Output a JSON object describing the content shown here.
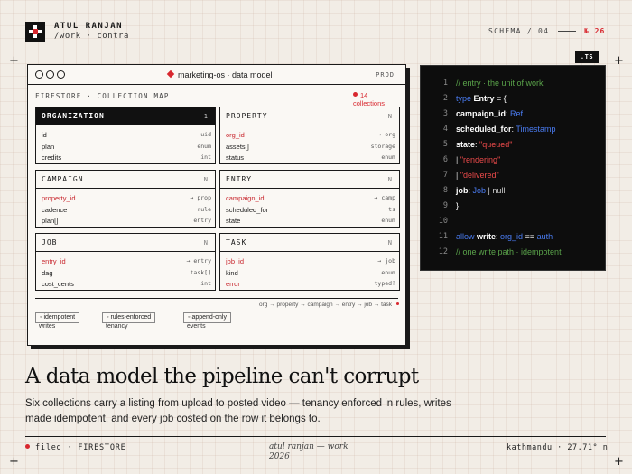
{
  "header": {
    "brand_name": "ATUL RANJAN",
    "brand_path": "/work · contra",
    "schema_label": "SCHEMA / 04",
    "page_index": "№ 26"
  },
  "panel": {
    "title": "marketing-os · data model",
    "env_badge": "PROD",
    "section_label": "FIRESTORE · COLLECTION MAP",
    "collection_count": "14",
    "collection_count_label": "collections",
    "cards": [
      {
        "name": "ORGANIZATION",
        "tag": "1",
        "rows": [
          {
            "field": "id",
            "type": "uid",
            "key": false
          },
          {
            "field": "plan",
            "type": "enum",
            "key": false
          },
          {
            "field": "credits",
            "type": "int",
            "key": false
          }
        ]
      },
      {
        "name": "PROPERTY",
        "tag": "N",
        "rows": [
          {
            "field": "org_id",
            "type": "→ org",
            "key": true
          },
          {
            "field": "assets[]",
            "type": "storage",
            "key": false
          },
          {
            "field": "status",
            "type": "enum",
            "key": false
          }
        ]
      },
      {
        "name": "CAMPAIGN",
        "tag": "N",
        "rows": [
          {
            "field": "property_id",
            "type": "→ prop",
            "key": true
          },
          {
            "field": "cadence",
            "type": "rule",
            "key": false
          },
          {
            "field": "plan[]",
            "type": "entry",
            "key": false
          }
        ]
      },
      {
        "name": "ENTRY",
        "tag": "N",
        "rows": [
          {
            "field": "campaign_id",
            "type": "→ camp",
            "key": true
          },
          {
            "field": "scheduled_for",
            "type": "ts",
            "key": false
          },
          {
            "field": "state",
            "type": "enum",
            "key": false
          }
        ]
      },
      {
        "name": "JOB",
        "tag": "N",
        "rows": [
          {
            "field": "entry_id",
            "type": "→ entry",
            "key": true
          },
          {
            "field": "dag",
            "type": "task[]",
            "key": false
          },
          {
            "field": "cost_cents",
            "type": "int",
            "key": false
          }
        ]
      },
      {
        "name": "TASK",
        "tag": "N",
        "rows": [
          {
            "field": "job_id",
            "type": "→ job",
            "key": true
          },
          {
            "field": "kind",
            "type": "enum",
            "key": false
          },
          {
            "field": "error",
            "type": "typed?",
            "key": true
          }
        ]
      }
    ],
    "flow": "org → property → campaign → entry → job → task",
    "chips": [
      {
        "label": "idempotent",
        "sub": "writes"
      },
      {
        "label": "rules-enforced",
        "sub": "tenancy"
      },
      {
        "label": "append-only",
        "sub": "events"
      }
    ]
  },
  "code": {
    "badge": ".TS",
    "line_numbers": [
      "1",
      "2",
      "3",
      "4",
      "5",
      "6",
      "7",
      "8",
      "9",
      "10",
      "11",
      "12"
    ],
    "lines": [
      {
        "parts": [
          {
            "c": "k-com",
            "t": "// entry · the unit of work"
          }
        ]
      },
      {
        "parts": [
          {
            "c": "k-kw",
            "t": "type "
          },
          {
            "c": "k-id",
            "t": "Entry"
          },
          {
            "c": "k-pl",
            "t": " = {"
          }
        ]
      },
      {
        "parts": [
          {
            "c": "k-id",
            "t": "campaign_id"
          },
          {
            "c": "k-pl",
            "t": ": "
          },
          {
            "c": "k-ty",
            "t": "Ref"
          }
        ]
      },
      {
        "parts": [
          {
            "c": "k-id",
            "t": "scheduled_for"
          },
          {
            "c": "k-pl",
            "t": ": "
          },
          {
            "c": "k-ty",
            "t": "Timestamp"
          }
        ]
      },
      {
        "parts": [
          {
            "c": "k-id",
            "t": "state"
          },
          {
            "c": "k-pl",
            "t": ": "
          },
          {
            "c": "k-str",
            "t": "\"queued\""
          }
        ]
      },
      {
        "parts": [
          {
            "c": "k-mut",
            "t": "| "
          },
          {
            "c": "k-str",
            "t": "\"rendering\""
          }
        ]
      },
      {
        "parts": [
          {
            "c": "k-mut",
            "t": "| "
          },
          {
            "c": "k-str",
            "t": "\"delivered\""
          }
        ]
      },
      {
        "parts": [
          {
            "c": "k-id",
            "t": "job"
          },
          {
            "c": "k-pl",
            "t": ": "
          },
          {
            "c": "k-ty",
            "t": "Job"
          },
          {
            "c": "k-mut",
            "t": " | null"
          }
        ]
      },
      {
        "parts": [
          {
            "c": "k-pl",
            "t": "}"
          }
        ]
      },
      {
        "parts": []
      },
      {
        "parts": [
          {
            "c": "k-kw",
            "t": "allow "
          },
          {
            "c": "k-id",
            "t": "write"
          },
          {
            "c": "k-pl",
            "t": ": "
          },
          {
            "c": "k-ty",
            "t": "org_id"
          },
          {
            "c": "k-pl",
            "t": " == "
          },
          {
            "c": "k-ty",
            "t": "auth"
          }
        ]
      },
      {
        "parts": [
          {
            "c": "k-com",
            "t": "// one write path · idempotent"
          }
        ]
      }
    ]
  },
  "hero": {
    "headline": "A data model the pipeline can't corrupt",
    "description": "Six collections carry a listing from upload to posted video — tenancy enforced in rules, writes made idempotent, and every job costed on the row it belongs to."
  },
  "footer": {
    "left": "filed · FIRESTORE",
    "center_line1": "atul ranjan — work",
    "center_line2": "2026",
    "right": "kathmandu · 27.71° n"
  },
  "colors": {
    "accent": "#d8282f",
    "code_bg": "#0d0d0d",
    "paper": "#f2ede6"
  }
}
